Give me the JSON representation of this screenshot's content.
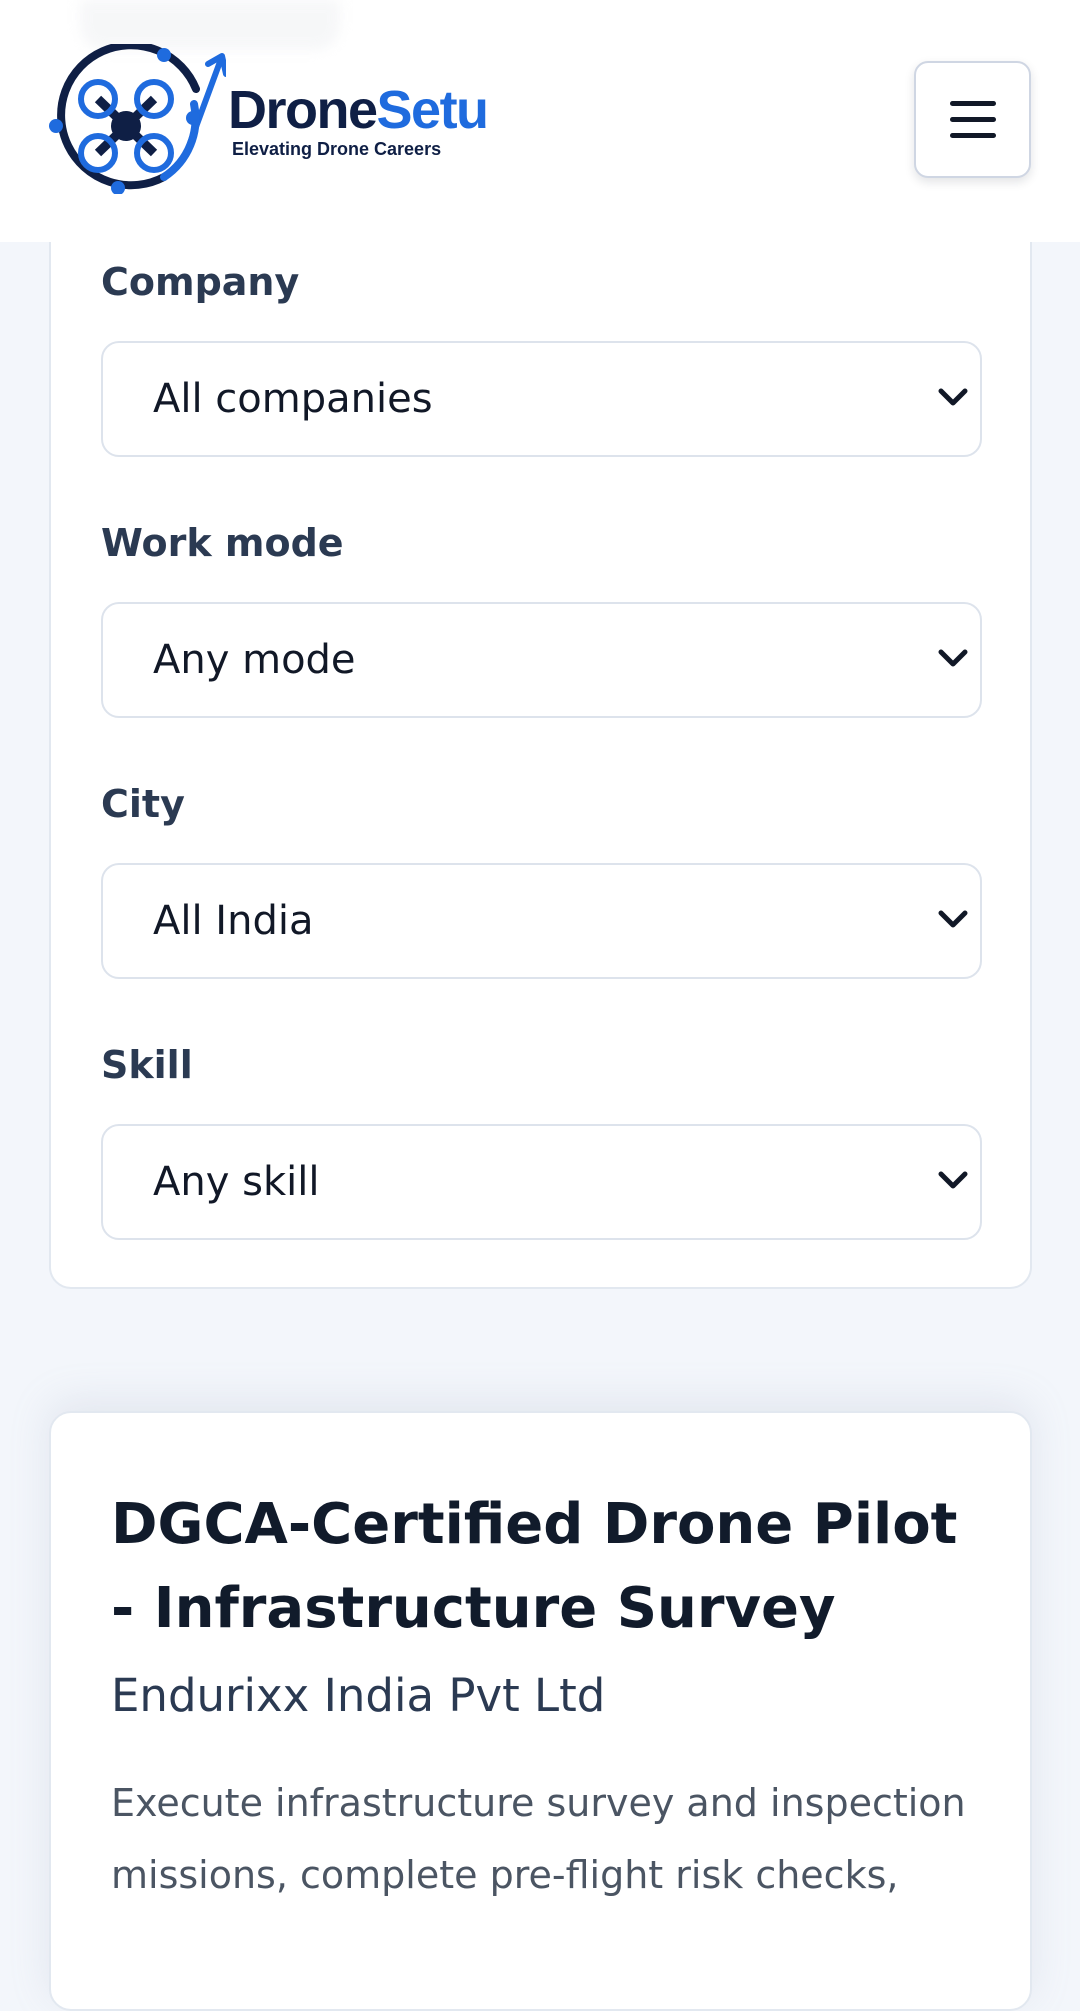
{
  "header": {
    "brand_dark": "Drone",
    "brand_accent": "Setu",
    "tagline": "Elevating Drone Careers",
    "menu_icon": "hamburger-icon",
    "colors": {
      "brand_dark": "#0f1f45",
      "brand_accent": "#1f6bde"
    }
  },
  "filters": {
    "company": {
      "label": "Company",
      "value": "All companies"
    },
    "work_mode": {
      "label": "Work mode",
      "value": "Any mode"
    },
    "city": {
      "label": "City",
      "value": "All India"
    },
    "skill": {
      "label": "Skill",
      "value": "Any skill"
    }
  },
  "job": {
    "title": "DGCA-Certified Drone Pilot - Infrastructure Survey",
    "company": "Endurixx India Pvt Ltd",
    "description": "Execute infrastructure survey and inspection missions, complete pre-flight risk checks,"
  }
}
